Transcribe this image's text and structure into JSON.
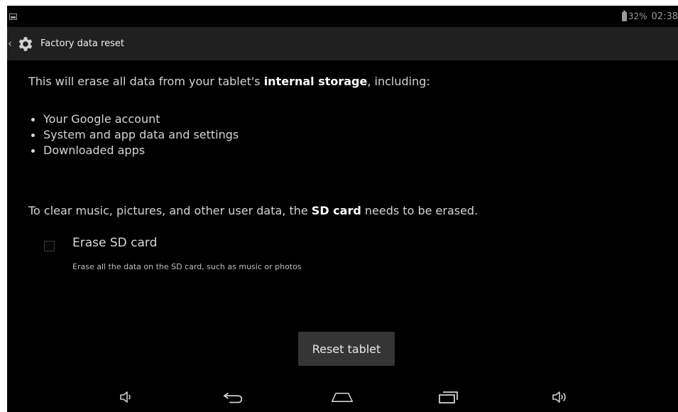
{
  "status_bar": {
    "battery_percent": "32%",
    "time": "02:38"
  },
  "action_bar": {
    "title": "Factory data reset",
    "icon": "gear-icon"
  },
  "content": {
    "intro_prefix": "This will erase all data from your tablet's ",
    "intro_bold": "internal storage",
    "intro_suffix": ", including:",
    "bullets": [
      "Your Google account",
      "System and app data and settings",
      "Downloaded apps"
    ],
    "sd_prefix": "To clear music, pictures, and other user data, the ",
    "sd_bold": "SD card",
    "sd_suffix": " needs to be erased.",
    "erase_sd": {
      "title": "Erase SD card",
      "subtitle": "Erase all the data on the SD card, such as music or photos",
      "checked": false
    },
    "reset_button_label": "Reset tablet"
  },
  "nav_bar": {
    "icons": [
      "volume-down-icon",
      "back-icon",
      "home-icon",
      "recent-apps-icon",
      "volume-up-icon"
    ]
  }
}
